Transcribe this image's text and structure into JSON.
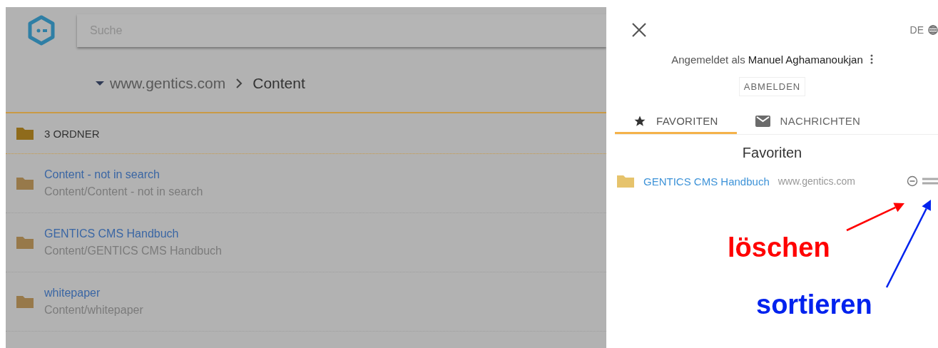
{
  "header": {
    "search": {
      "placeholder": "Suche"
    }
  },
  "breadcrumb": {
    "site": "www.gentics.com",
    "current": "Content"
  },
  "folder_list": {
    "heading": "3 ORDNER",
    "items": [
      {
        "name": "Content - not in search",
        "path": "Content/Content - not in search"
      },
      {
        "name": "GENTICS CMS Handbuch",
        "path": "Content/GENTICS CMS Handbuch"
      },
      {
        "name": "whitepaper",
        "path": "Content/whitepaper"
      }
    ]
  },
  "panel": {
    "language": "DE",
    "login_text": "Angemeldet als **Manuel Aghamanoukjan**",
    "logout": "ABMELDEN",
    "tabs": [
      {
        "label": "FAVORITEN",
        "kind": "star",
        "selected": true
      },
      {
        "label": "NACHRICHTEN",
        "kind": "mail",
        "selected": false
      }
    ],
    "favorites_title": "Favoriten",
    "favorites": [
      {
        "name": "GENTICS CMS Handbuch",
        "site": "www.gentics.com"
      }
    ]
  },
  "annotations": [
    {
      "label": "löschen",
      "color": "#ff0000"
    },
    {
      "label": "sortieren",
      "color": "#0022ee"
    }
  ]
}
